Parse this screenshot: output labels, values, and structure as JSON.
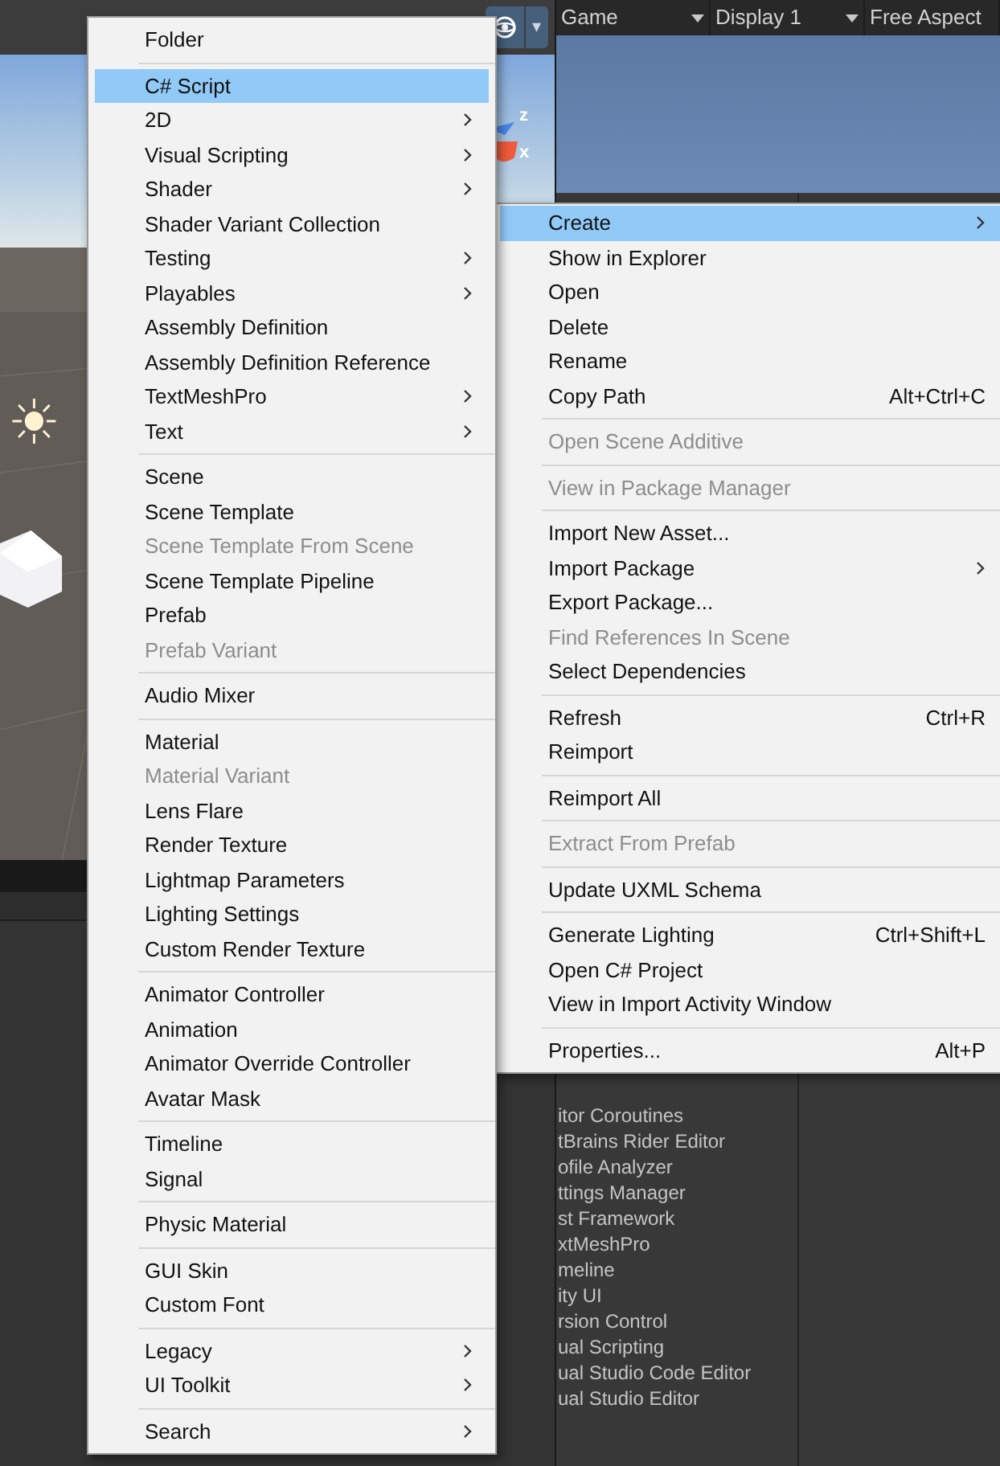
{
  "scene_toolbar": {
    "gizmo_menu": "▾"
  },
  "game_toolbar": {
    "items": [
      {
        "label": "Game",
        "caret": true
      },
      {
        "label": "Display 1",
        "caret": true
      },
      {
        "label": "Free Aspect",
        "caret": false
      }
    ]
  },
  "axis_labels": [
    "z",
    "x"
  ],
  "package_list": [
    "itor Coroutines",
    "tBrains Rider Editor",
    "ofile Analyzer",
    "ttings Manager",
    "st Framework",
    "xtMeshPro",
    "meline",
    "ity UI",
    "rsion Control",
    "ual Scripting",
    "ual Studio Code Editor",
    "ual Studio Editor"
  ],
  "create_menu": {
    "groups": [
      {
        "items": [
          {
            "label": "Folder",
            "submenu": false,
            "disabled": false,
            "selected": false
          }
        ]
      },
      {
        "items": [
          {
            "label": "C# Script",
            "submenu": false,
            "disabled": false,
            "selected": true
          },
          {
            "label": "2D",
            "submenu": true,
            "disabled": false,
            "selected": false
          },
          {
            "label": "Visual Scripting",
            "submenu": true,
            "disabled": false,
            "selected": false
          },
          {
            "label": "Shader",
            "submenu": true,
            "disabled": false,
            "selected": false
          },
          {
            "label": "Shader Variant Collection",
            "submenu": false,
            "disabled": false,
            "selected": false
          },
          {
            "label": "Testing",
            "submenu": true,
            "disabled": false,
            "selected": false
          },
          {
            "label": "Playables",
            "submenu": true,
            "disabled": false,
            "selected": false
          },
          {
            "label": "Assembly Definition",
            "submenu": false,
            "disabled": false,
            "selected": false
          },
          {
            "label": "Assembly Definition Reference",
            "submenu": false,
            "disabled": false,
            "selected": false
          },
          {
            "label": "TextMeshPro",
            "submenu": true,
            "disabled": false,
            "selected": false
          },
          {
            "label": "Text",
            "submenu": true,
            "disabled": false,
            "selected": false
          }
        ]
      },
      {
        "items": [
          {
            "label": "Scene",
            "submenu": false,
            "disabled": false,
            "selected": false
          },
          {
            "label": "Scene Template",
            "submenu": false,
            "disabled": false,
            "selected": false
          },
          {
            "label": "Scene Template From Scene",
            "submenu": false,
            "disabled": true,
            "selected": false
          },
          {
            "label": "Scene Template Pipeline",
            "submenu": false,
            "disabled": false,
            "selected": false
          },
          {
            "label": "Prefab",
            "submenu": false,
            "disabled": false,
            "selected": false
          },
          {
            "label": "Prefab Variant",
            "submenu": false,
            "disabled": true,
            "selected": false
          }
        ]
      },
      {
        "items": [
          {
            "label": "Audio Mixer",
            "submenu": false,
            "disabled": false,
            "selected": false
          }
        ]
      },
      {
        "items": [
          {
            "label": "Material",
            "submenu": false,
            "disabled": false,
            "selected": false
          },
          {
            "label": "Material Variant",
            "submenu": false,
            "disabled": true,
            "selected": false
          },
          {
            "label": "Lens Flare",
            "submenu": false,
            "disabled": false,
            "selected": false
          },
          {
            "label": "Render Texture",
            "submenu": false,
            "disabled": false,
            "selected": false
          },
          {
            "label": "Lightmap Parameters",
            "submenu": false,
            "disabled": false,
            "selected": false
          },
          {
            "label": "Lighting Settings",
            "submenu": false,
            "disabled": false,
            "selected": false
          },
          {
            "label": "Custom Render Texture",
            "submenu": false,
            "disabled": false,
            "selected": false
          }
        ]
      },
      {
        "items": [
          {
            "label": "Animator Controller",
            "submenu": false,
            "disabled": false,
            "selected": false
          },
          {
            "label": "Animation",
            "submenu": false,
            "disabled": false,
            "selected": false
          },
          {
            "label": "Animator Override Controller",
            "submenu": false,
            "disabled": false,
            "selected": false
          },
          {
            "label": "Avatar Mask",
            "submenu": false,
            "disabled": false,
            "selected": false
          }
        ]
      },
      {
        "items": [
          {
            "label": "Timeline",
            "submenu": false,
            "disabled": false,
            "selected": false
          },
          {
            "label": "Signal",
            "submenu": false,
            "disabled": false,
            "selected": false
          }
        ]
      },
      {
        "items": [
          {
            "label": "Physic Material",
            "submenu": false,
            "disabled": false,
            "selected": false
          }
        ]
      },
      {
        "items": [
          {
            "label": "GUI Skin",
            "submenu": false,
            "disabled": false,
            "selected": false
          },
          {
            "label": "Custom Font",
            "submenu": false,
            "disabled": false,
            "selected": false
          }
        ]
      },
      {
        "items": [
          {
            "label": "Legacy",
            "submenu": true,
            "disabled": false,
            "selected": false
          },
          {
            "label": "UI Toolkit",
            "submenu": true,
            "disabled": false,
            "selected": false
          }
        ]
      },
      {
        "items": [
          {
            "label": "Search",
            "submenu": true,
            "disabled": false,
            "selected": false
          }
        ]
      }
    ]
  },
  "context_menu": {
    "groups": [
      {
        "items": [
          {
            "label": "Create",
            "submenu": true,
            "disabled": false,
            "selected": true
          },
          {
            "label": "Show in Explorer",
            "submenu": false,
            "disabled": false,
            "selected": false
          },
          {
            "label": "Open",
            "submenu": false,
            "disabled": false,
            "selected": false
          },
          {
            "label": "Delete",
            "submenu": false,
            "disabled": false,
            "selected": false
          },
          {
            "label": "Rename",
            "submenu": false,
            "disabled": false,
            "selected": false
          },
          {
            "label": "Copy Path",
            "shortcut": "Alt+Ctrl+C",
            "submenu": false,
            "disabled": false,
            "selected": false
          }
        ]
      },
      {
        "items": [
          {
            "label": "Open Scene Additive",
            "submenu": false,
            "disabled": true,
            "selected": false
          }
        ]
      },
      {
        "items": [
          {
            "label": "View in Package Manager",
            "submenu": false,
            "disabled": true,
            "selected": false
          }
        ]
      },
      {
        "items": [
          {
            "label": "Import New Asset...",
            "submenu": false,
            "disabled": false,
            "selected": false
          },
          {
            "label": "Import Package",
            "submenu": true,
            "disabled": false,
            "selected": false
          },
          {
            "label": "Export Package...",
            "submenu": false,
            "disabled": false,
            "selected": false
          },
          {
            "label": "Find References In Scene",
            "submenu": false,
            "disabled": true,
            "selected": false
          },
          {
            "label": "Select Dependencies",
            "submenu": false,
            "disabled": false,
            "selected": false
          }
        ]
      },
      {
        "items": [
          {
            "label": "Refresh",
            "shortcut": "Ctrl+R",
            "submenu": false,
            "disabled": false,
            "selected": false
          },
          {
            "label": "Reimport",
            "submenu": false,
            "disabled": false,
            "selected": false
          }
        ]
      },
      {
        "items": [
          {
            "label": "Reimport All",
            "submenu": false,
            "disabled": false,
            "selected": false
          }
        ]
      },
      {
        "items": [
          {
            "label": "Extract From Prefab",
            "submenu": false,
            "disabled": true,
            "selected": false
          }
        ]
      },
      {
        "items": [
          {
            "label": "Update UXML Schema",
            "submenu": false,
            "disabled": false,
            "selected": false
          }
        ]
      },
      {
        "items": [
          {
            "label": "Generate Lighting",
            "shortcut": "Ctrl+Shift+L",
            "submenu": false,
            "disabled": false,
            "selected": false
          },
          {
            "label": "Open C# Project",
            "submenu": false,
            "disabled": false,
            "selected": false
          },
          {
            "label": "View in Import Activity Window",
            "submenu": false,
            "disabled": false,
            "selected": false
          }
        ]
      },
      {
        "items": [
          {
            "label": "Properties...",
            "shortcut": "Alt+P",
            "submenu": false,
            "disabled": false,
            "selected": false
          }
        ]
      }
    ]
  }
}
